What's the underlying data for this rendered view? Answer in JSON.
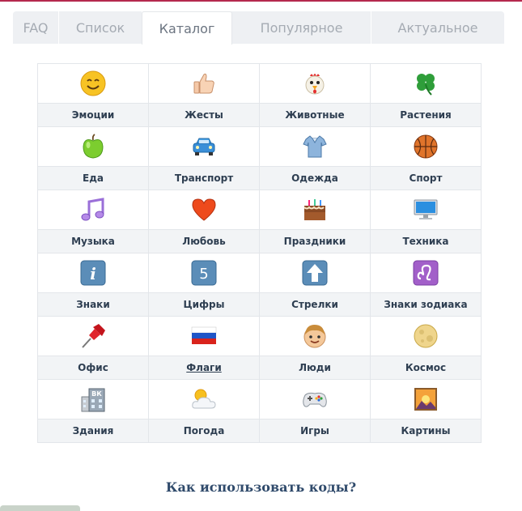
{
  "tabs": [
    {
      "label": "FAQ"
    },
    {
      "label": "Список"
    },
    {
      "label": "Каталог"
    },
    {
      "label": "Популярное"
    },
    {
      "label": "Актуальное"
    }
  ],
  "active_tab": "Каталог",
  "categories": [
    {
      "label": "Эмоции",
      "icon": "smiley-face-icon"
    },
    {
      "label": "Жесты",
      "icon": "thumbs-up-icon"
    },
    {
      "label": "Животные",
      "icon": "chicken-icon"
    },
    {
      "label": "Растения",
      "icon": "four-leaf-clover-icon"
    },
    {
      "label": "Еда",
      "icon": "green-apple-icon"
    },
    {
      "label": "Транспорт",
      "icon": "blue-car-icon"
    },
    {
      "label": "Одежда",
      "icon": "shirt-icon"
    },
    {
      "label": "Спорт",
      "icon": "basketball-icon"
    },
    {
      "label": "Музыка",
      "icon": "music-note-icon"
    },
    {
      "label": "Любовь",
      "icon": "red-heart-icon"
    },
    {
      "label": "Праздники",
      "icon": "birthday-cake-icon"
    },
    {
      "label": "Техника",
      "icon": "computer-monitor-icon"
    },
    {
      "label": "Знаки",
      "icon": "info-sign-icon"
    },
    {
      "label": "Цифры",
      "icon": "number-five-icon"
    },
    {
      "label": "Стрелки",
      "icon": "up-arrow-icon"
    },
    {
      "label": "Знаки зодиака",
      "icon": "leo-zodiac-icon"
    },
    {
      "label": "Офис",
      "icon": "pushpin-icon"
    },
    {
      "label": "Флаги",
      "icon": "russian-flag-icon"
    },
    {
      "label": "Люди",
      "icon": "boy-face-icon"
    },
    {
      "label": "Космос",
      "icon": "moon-icon"
    },
    {
      "label": "Здания",
      "icon": "building-icon"
    },
    {
      "label": "Погода",
      "icon": "sun-behind-cloud-icon"
    },
    {
      "label": "Игры",
      "icon": "gamepad-icon"
    },
    {
      "label": "Картины",
      "icon": "sunset-picture-icon"
    }
  ],
  "footer": {
    "howto_label": "Как использовать коды?"
  },
  "colors": {
    "accent": "#b5294e",
    "label_text": "#2e3e51",
    "cell_border": "#e3e6ea",
    "label_bg": "#f2f4f6"
  }
}
